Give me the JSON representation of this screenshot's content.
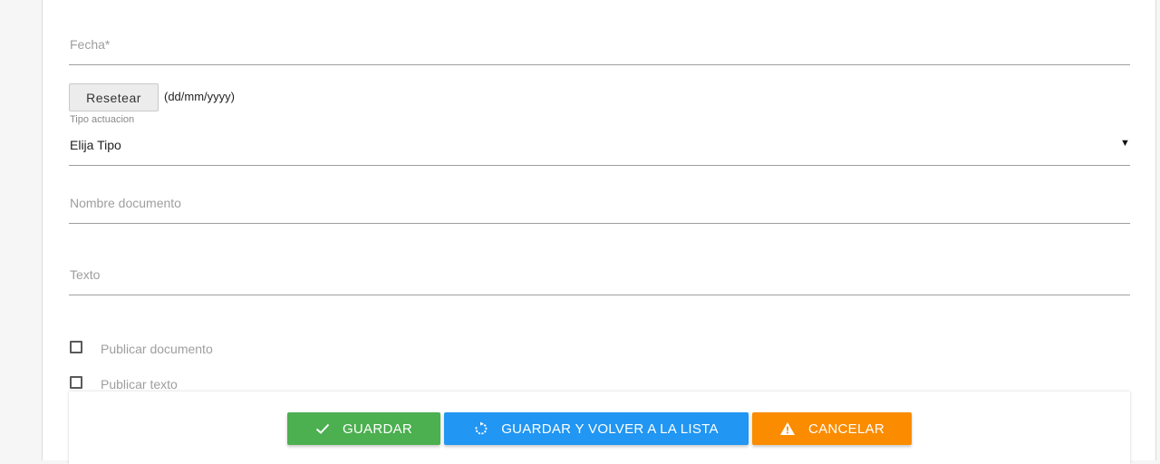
{
  "form": {
    "fecha_placeholder": "Fecha*",
    "reset_label": "Resetear",
    "date_format": "(dd/mm/yyyy)",
    "tipo_label": "Tipo actuacion",
    "tipo_value": "Elija Tipo",
    "tipo_arrow": "▼",
    "nombre_placeholder": "Nombre documento",
    "texto_placeholder": "Texto",
    "publicar_documento_label": "Publicar documento",
    "publicar_texto_label": "Publicar texto"
  },
  "actions": {
    "guardar_label": "GUARDAR",
    "guardar_volver_label": "GUARDAR Y VOLVER A LA LISTA",
    "cancelar_label": "CANCELAR"
  },
  "icons": {
    "guardar": "check-icon",
    "guardar_volver": "refresh-icon",
    "cancelar": "warning-icon"
  },
  "colors": {
    "guardar": "#4caf50",
    "guardar_volver": "#2196f3",
    "cancelar": "#fb8c00"
  }
}
